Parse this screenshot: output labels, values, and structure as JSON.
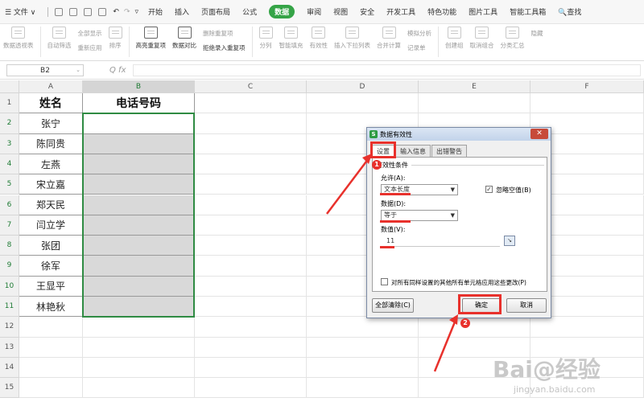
{
  "menu": {
    "file": "☰ 文件 ∨",
    "tabs": [
      "开始",
      "插入",
      "页面布局",
      "公式",
      "数据",
      "审阅",
      "视图",
      "安全",
      "开发工具",
      "特色功能",
      "图片工具",
      "智能工具箱"
    ],
    "active_tab": "数据",
    "search": "🔍查找"
  },
  "ribbon": {
    "pivot": "数据透视表",
    "autofilter": "自动筛选",
    "show_all": "全部显示",
    "reapply": "重新应用",
    "sort": "排序",
    "highlight_dup": "高亮重复项",
    "compare": "数据对比",
    "remove_dup": "删除重复项",
    "reject_dup": "拒绝录入重复项",
    "split": "分列",
    "fill": "智能填充",
    "validity": "有效性",
    "dropdown": "插入下拉列表",
    "consolidate": "合并计算",
    "simulation": "模拟分析",
    "record": "记录单",
    "group": "创建组",
    "ungroup": "取消组合",
    "subtotal": "分类汇总",
    "hide": "隐藏"
  },
  "formula_bar": {
    "name_box": "B2",
    "fx": "Q  fx"
  },
  "sheet": {
    "columns": [
      "A",
      "B",
      "C",
      "D",
      "E",
      "F"
    ],
    "rows": [
      "1",
      "2",
      "3",
      "4",
      "5",
      "6",
      "7",
      "8",
      "9",
      "10",
      "11",
      "12",
      "13",
      "14",
      "15"
    ],
    "header_a": "姓名",
    "header_b": "电话号码",
    "names": [
      "张宁",
      "陈同贵",
      "左燕",
      "宋立嘉",
      "郑天民",
      "闫立学",
      "张团",
      "徐军",
      "王显平",
      "林艳秋"
    ]
  },
  "dialog": {
    "title": "数据有效性",
    "close": "✕",
    "tabs": [
      "设置",
      "输入信息",
      "出错警告"
    ],
    "group_label": "有效性条件",
    "allow_label": "允许(A):",
    "allow_value": "文本长度",
    "ignore_blank": "忽略空值(B)",
    "data_label": "数据(D):",
    "data_value": "等于",
    "value_label": "数值(V):",
    "value": "11",
    "apply_all": "对所有同样设置的其他所有单元格应用这些更改(P)",
    "clear_all": "全部清除(C)",
    "ok": "确定",
    "cancel": "取消"
  },
  "annotations": {
    "badge1": "1",
    "badge2": "2",
    "color": "#e8312c"
  },
  "watermark": {
    "main": "Bai@经验",
    "url": "jingyan.baidu.com"
  }
}
